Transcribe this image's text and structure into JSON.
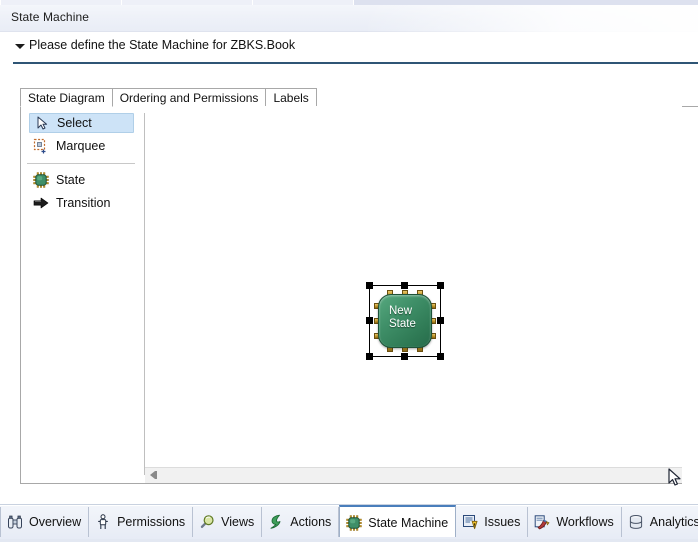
{
  "window": {
    "title": "State Machine"
  },
  "description": {
    "text": "Please define the State Machine for ZBKS.Book",
    "twisty_icon": "triangle-down-icon"
  },
  "inner_tabs": [
    {
      "label": "State Diagram",
      "active": true
    },
    {
      "label": "Ordering and Permissions",
      "active": false
    },
    {
      "label": "Labels",
      "active": false
    }
  ],
  "palette": {
    "items": [
      {
        "label": "Select",
        "icon": "cursor-arrow-icon",
        "selected": true
      },
      {
        "label": "Marquee",
        "icon": "marquee-select-icon",
        "selected": false
      },
      {
        "label": "State",
        "icon": "chip-icon",
        "selected": false
      },
      {
        "label": "Transition",
        "icon": "right-arrow-icon",
        "selected": false
      }
    ]
  },
  "canvas": {
    "node": {
      "label_line1": "New",
      "label_line2": "State",
      "selected": true,
      "icon": "chip-icon"
    },
    "scrollbar": {
      "left_arrow_icon": "scroll-left-arrow-icon"
    }
  },
  "bottom_tabs": [
    {
      "label": "Overview",
      "icon": "binoculars-icon",
      "active": false
    },
    {
      "label": "Permissions",
      "icon": "person-lock-icon",
      "active": false
    },
    {
      "label": "Views",
      "icon": "magnifier-icon",
      "active": false
    },
    {
      "label": "Actions",
      "icon": "lightning-icon",
      "active": false
    },
    {
      "label": "State Machine",
      "icon": "chip-icon",
      "active": true
    },
    {
      "label": "Issues",
      "icon": "issues-icon",
      "active": false
    },
    {
      "label": "Workflows",
      "icon": "workflows-icon",
      "active": false
    },
    {
      "label": "Analytics",
      "icon": "database-icon",
      "active": false
    }
  ],
  "colors": {
    "accent_rule": "#2f5575",
    "active_tab_border": "#4a7ebb",
    "selection_highlight": "#cde3f7",
    "node_green": "#3f8f68",
    "node_pin_gold": "#c79a2c"
  },
  "cursor": {
    "icon": "mouse-pointer-icon"
  }
}
